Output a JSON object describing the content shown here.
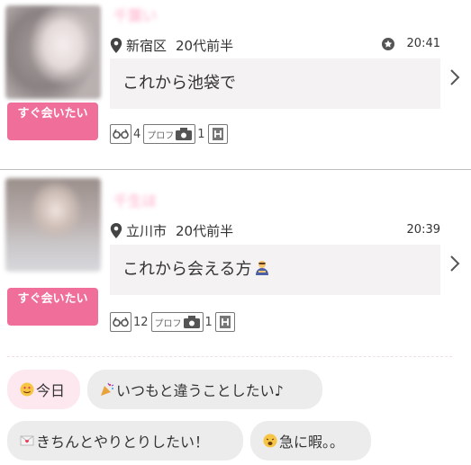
{
  "posts": [
    {
      "name": "千葉い",
      "area": "新宿区",
      "age": "20代前半",
      "time": "20:41",
      "message": "これから池袋で",
      "badge": "すぐ会いたい",
      "footprints": "4",
      "prof_label": "プロフ",
      "photo_count": "1",
      "has_star": true
    },
    {
      "name": "千生ほ",
      "area": "立川市",
      "age": "20代前半",
      "time": "20:39",
      "message": "これから会える方",
      "badge": "すぐ会いたい",
      "footprints": "12",
      "prof_label": "プロフ",
      "photo_count": "1",
      "has_star": false
    }
  ],
  "tags": [
    {
      "label": "今日",
      "icon": "smiling-face-hearts-icon"
    },
    {
      "label": "いつもと違うことしたい♪",
      "icon": "party-popper-icon"
    },
    {
      "label": "きちんとやりとりしたい！",
      "icon": "love-letter-icon"
    },
    {
      "label": "急に暇。。",
      "icon": "weary-face-icon"
    }
  ],
  "colors": {
    "badge": "#f06f9a",
    "name": "#ffc7d8",
    "message_bg": "#f4f2f3",
    "tag_bg": "#ececec",
    "tag_active_bg": "#fde8ef"
  }
}
